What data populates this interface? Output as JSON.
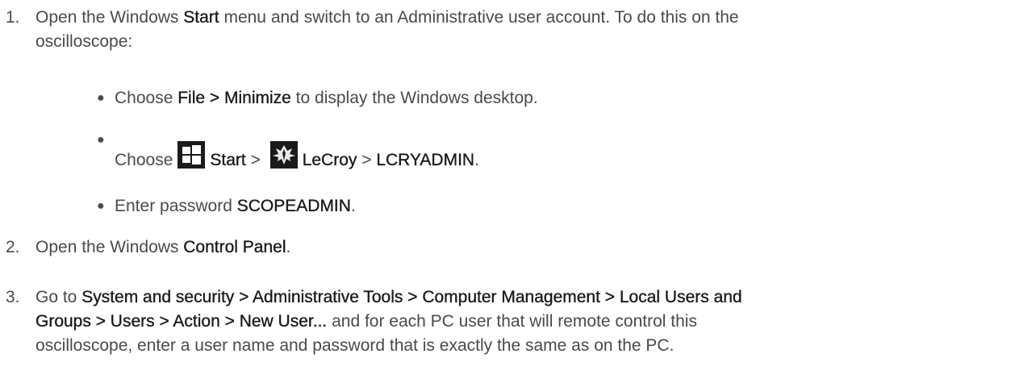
{
  "steps": [
    {
      "number": "1.",
      "line1_a": "Open the Windows ",
      "line1_b": "Start",
      "line1_c": " menu and switch to an Administrative user account. To do this on the",
      "line2": "oscilloscope:",
      "substeps": [
        {
          "a": "Choose ",
          "b": "File > Minimize",
          "c": " to display the Windows desktop."
        },
        {
          "a": "Choose",
          "icon1": "windows-start-icon",
          "b": "Start",
          "c": " > ",
          "icon2": "teledyne-lecroy-logo-icon",
          "d": "LeCroy",
          "e": " > ",
          "f": "LCRYADMIN",
          "g": "."
        },
        {
          "a": "Enter password ",
          "b": "SCOPEADMIN",
          "c": "."
        }
      ]
    },
    {
      "number": "2.",
      "a": "Open the Windows ",
      "b": "Control Panel",
      "c": "."
    },
    {
      "number": "3.",
      "a": "Go to ",
      "b": "System and security > Administrative Tools > Computer Management > Local Users and",
      "b2": "Groups > Users > Action > New User...",
      "c": " and for each PC user that will remote control this",
      "line3": "oscilloscope, enter a user name and password that is exactly the same as on the PC."
    }
  ]
}
